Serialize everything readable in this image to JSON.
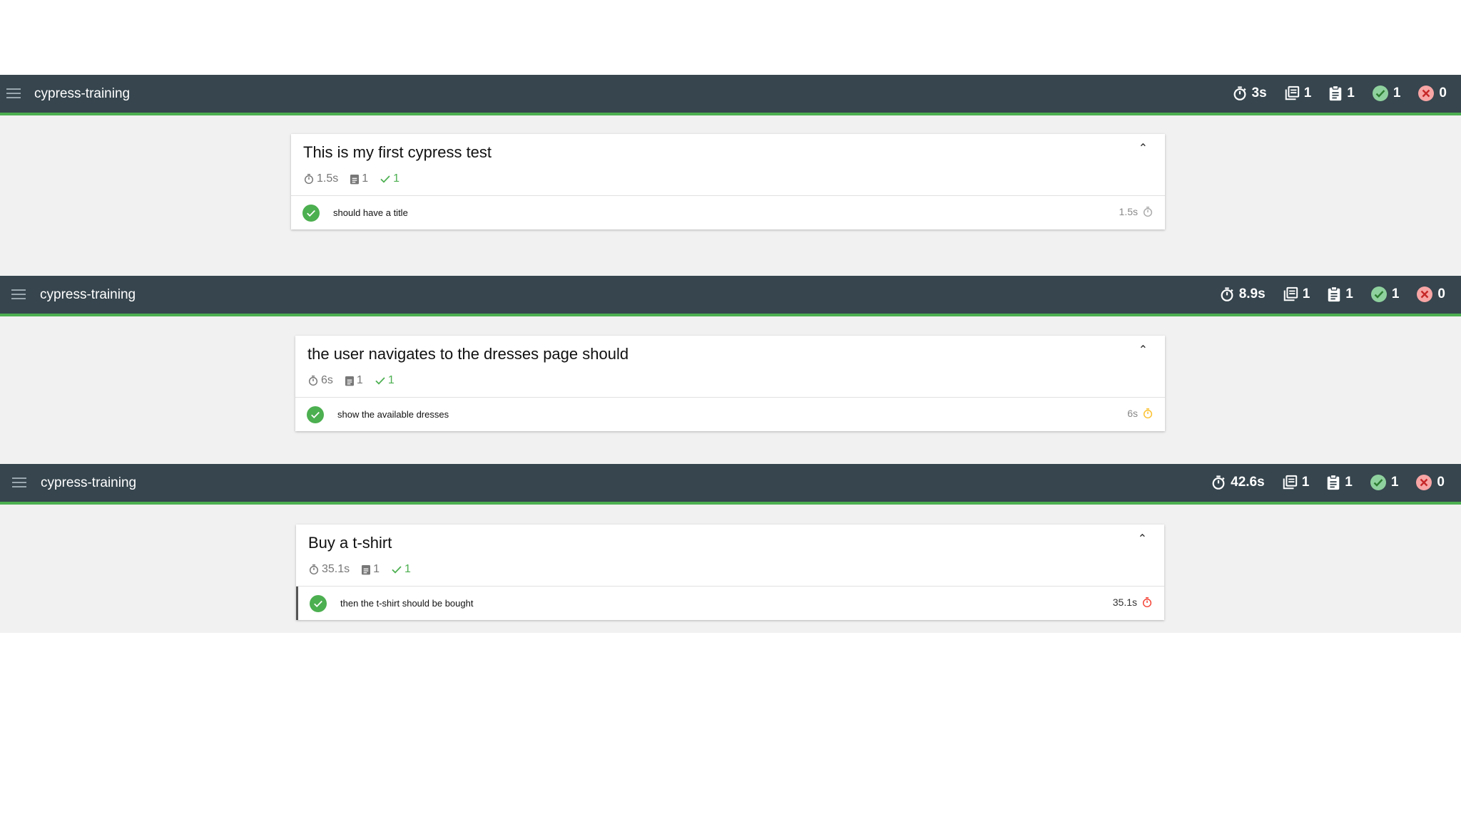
{
  "colors": {
    "navbar": "#36454e",
    "accent": "#4caf50",
    "fail": "#f44336",
    "warning": "#fbc02d",
    "background": "#f1f1f1"
  },
  "reports": [
    {
      "app_title": "cypress-training",
      "stats": {
        "duration": "3s",
        "suites": "1",
        "tests": "1",
        "passed": "1",
        "failed": "0"
      },
      "suite": {
        "title": "This is my first cypress test",
        "duration": "1.5s",
        "tests": "1",
        "passed": "1",
        "test": {
          "title": "should have a title",
          "duration": "1.5s",
          "speed": "normal",
          "status": "passed"
        }
      }
    },
    {
      "app_title": "cypress-training",
      "stats": {
        "duration": "8.9s",
        "suites": "1",
        "tests": "1",
        "passed": "1",
        "failed": "0"
      },
      "suite": {
        "title": "the user navigates to the dresses page should",
        "duration": "6s",
        "tests": "1",
        "passed": "1",
        "test": {
          "title": "show the available dresses",
          "duration": "6s",
          "speed": "medium",
          "status": "passed"
        }
      }
    },
    {
      "app_title": "cypress-training",
      "stats": {
        "duration": "42.6s",
        "suites": "1",
        "tests": "1",
        "passed": "1",
        "failed": "0"
      },
      "suite": {
        "title": "Buy a t-shirt",
        "duration": "35.1s",
        "tests": "1",
        "passed": "1",
        "test": {
          "title": "then the t-shirt should be bought",
          "duration": "35.1s",
          "speed": "slow",
          "status": "passed"
        }
      }
    }
  ]
}
